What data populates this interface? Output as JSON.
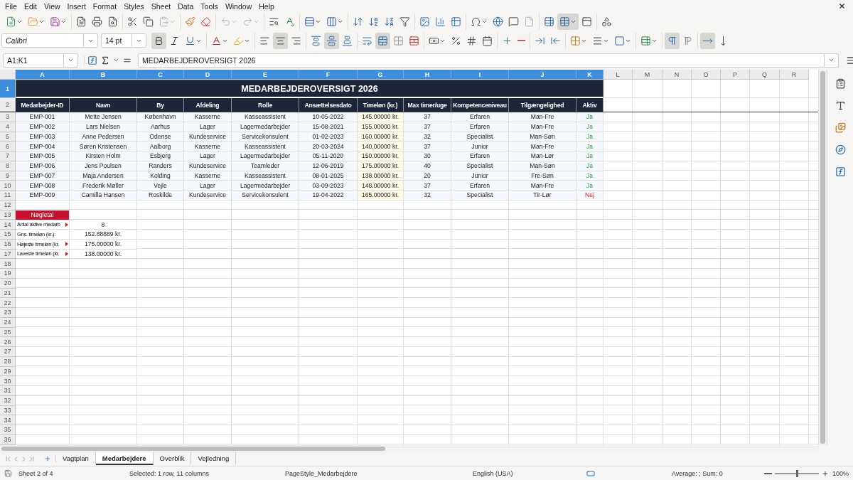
{
  "menu": [
    "File",
    "Edit",
    "View",
    "Insert",
    "Format",
    "Styles",
    "Sheet",
    "Data",
    "Tools",
    "Window",
    "Help"
  ],
  "toolbar": [
    [
      {
        "kind": "new",
        "on": false,
        "disabled": false
      },
      {
        "kind": "open",
        "on": false,
        "disabled": false
      },
      {
        "kind": "save",
        "on": false,
        "disabled": false
      }
    ],
    [
      {
        "kind": "export-pdf",
        "on": false,
        "disabled": false
      },
      {
        "kind": "print",
        "on": false,
        "disabled": false
      },
      {
        "kind": "print-preview",
        "on": false,
        "disabled": false
      }
    ],
    [
      {
        "kind": "cut",
        "on": false,
        "disabled": false
      },
      {
        "kind": "copy",
        "on": false,
        "disabled": false
      },
      {
        "kind": "paste",
        "on": false,
        "disabled": true
      }
    ],
    [
      {
        "kind": "clone",
        "on": false,
        "disabled": false
      },
      {
        "kind": "clear",
        "on": false,
        "disabled": false
      }
    ],
    [
      {
        "kind": "undo",
        "on": false,
        "disabled": true
      },
      {
        "kind": "redo",
        "on": false,
        "disabled": true
      }
    ],
    [
      {
        "kind": "find",
        "on": false,
        "disabled": false
      },
      {
        "kind": "spelling",
        "on": false,
        "disabled": false
      }
    ],
    [
      {
        "kind": "rows",
        "on": false,
        "disabled": false
      },
      {
        "kind": "columns",
        "on": false,
        "disabled": false
      }
    ],
    [
      {
        "kind": "sort",
        "on": false,
        "disabled": false
      },
      {
        "kind": "sort-asc",
        "on": false,
        "disabled": false
      },
      {
        "kind": "sort-desc",
        "on": false,
        "disabled": false
      },
      {
        "kind": "autofilter",
        "on": false,
        "disabled": false
      }
    ],
    [
      {
        "kind": "image",
        "on": false,
        "disabled": false
      },
      {
        "kind": "chart",
        "on": false,
        "disabled": false
      },
      {
        "kind": "pivot",
        "on": false,
        "disabled": false
      }
    ],
    [
      {
        "kind": "special-char",
        "on": false,
        "disabled": false
      },
      {
        "kind": "hyperlink",
        "on": false,
        "disabled": false
      },
      {
        "kind": "comment",
        "on": false,
        "disabled": false
      },
      {
        "kind": "header-footer",
        "on": false,
        "disabled": true
      }
    ],
    [
      {
        "kind": "print-area",
        "on": false,
        "disabled": false
      },
      {
        "kind": "freeze",
        "on": true,
        "disabled": false
      },
      {
        "kind": "split",
        "on": false,
        "disabled": false
      }
    ],
    [
      {
        "kind": "shapes",
        "on": false,
        "disabled": false
      }
    ]
  ],
  "font_name": "Calibri",
  "font_size": "14 pt",
  "format_toolbar": [
    [
      {
        "kind": "bold",
        "on": true
      },
      {
        "kind": "italic",
        "on": false
      },
      {
        "kind": "underline",
        "on": false
      }
    ],
    [
      {
        "kind": "font-color",
        "on": false
      },
      {
        "kind": "highlight",
        "on": false
      }
    ],
    [
      {
        "kind": "align-left",
        "on": false
      },
      {
        "kind": "align-center",
        "on": true
      },
      {
        "kind": "align-right",
        "on": false
      }
    ],
    [
      {
        "kind": "align-top",
        "on": false
      },
      {
        "kind": "align-middle",
        "on": true
      },
      {
        "kind": "align-bottom",
        "on": false
      }
    ],
    [
      {
        "kind": "wrap",
        "on": false
      },
      {
        "kind": "merge-center",
        "on": true
      },
      {
        "kind": "merge",
        "on": false
      },
      {
        "kind": "unmerge",
        "on": false
      }
    ],
    [
      {
        "kind": "currency",
        "on": false
      },
      {
        "kind": "percent",
        "on": false
      },
      {
        "kind": "number",
        "on": false
      },
      {
        "kind": "date",
        "on": false
      }
    ],
    [
      {
        "kind": "add-decimal",
        "on": false
      },
      {
        "kind": "delete-decimal",
        "on": false
      }
    ],
    [
      {
        "kind": "indent-increase",
        "on": false
      },
      {
        "kind": "indent-decrease",
        "on": false
      }
    ],
    [
      {
        "kind": "borders",
        "on": false
      },
      {
        "kind": "border-style",
        "on": false
      },
      {
        "kind": "border-color",
        "on": false
      }
    ],
    [
      {
        "kind": "conditional",
        "on": false
      }
    ],
    [
      {
        "kind": "ltr",
        "on": true
      },
      {
        "kind": "rtl",
        "on": false
      }
    ],
    [
      {
        "kind": "text-lr",
        "on": true
      },
      {
        "kind": "text-tb",
        "on": false
      }
    ]
  ],
  "name_box": "A1:K1",
  "formula": "MEDARBEJDEROVERSIGT 2026",
  "columns": [
    {
      "label": "A",
      "selected": true
    },
    {
      "label": "B",
      "selected": true
    },
    {
      "label": "C",
      "selected": true
    },
    {
      "label": "D",
      "selected": true
    },
    {
      "label": "E",
      "selected": true
    },
    {
      "label": "F",
      "selected": true
    },
    {
      "label": "G",
      "selected": true
    },
    {
      "label": "H",
      "selected": true
    },
    {
      "label": "I",
      "selected": true
    },
    {
      "label": "J",
      "selected": true
    },
    {
      "label": "K",
      "selected": true
    },
    {
      "label": "L",
      "selected": false
    },
    {
      "label": "M",
      "selected": false
    },
    {
      "label": "N",
      "selected": false
    },
    {
      "label": "O",
      "selected": false
    },
    {
      "label": "P",
      "selected": false
    },
    {
      "label": "Q",
      "selected": false
    },
    {
      "label": "R",
      "selected": false
    }
  ],
  "rows": [
    {
      "label": "1",
      "selected": true
    },
    {
      "label": "2",
      "selected": false
    },
    {
      "label": "3",
      "selected": false
    },
    {
      "label": "4",
      "selected": false
    },
    {
      "label": "5",
      "selected": false
    },
    {
      "label": "6",
      "selected": false
    },
    {
      "label": "7",
      "selected": false
    },
    {
      "label": "8",
      "selected": false
    },
    {
      "label": "9",
      "selected": false
    },
    {
      "label": "10",
      "selected": false
    },
    {
      "label": "11",
      "selected": false
    },
    {
      "label": "12",
      "selected": false
    },
    {
      "label": "13",
      "selected": false
    },
    {
      "label": "14",
      "selected": false
    },
    {
      "label": "15",
      "selected": false
    },
    {
      "label": "16",
      "selected": false
    },
    {
      "label": "17",
      "selected": false
    },
    {
      "label": "18",
      "selected": false
    },
    {
      "label": "19",
      "selected": false
    },
    {
      "label": "20",
      "selected": false
    },
    {
      "label": "21",
      "selected": false
    },
    {
      "label": "22",
      "selected": false
    },
    {
      "label": "23",
      "selected": false
    },
    {
      "label": "24",
      "selected": false
    },
    {
      "label": "25",
      "selected": false
    },
    {
      "label": "26",
      "selected": false
    },
    {
      "label": "27",
      "selected": false
    },
    {
      "label": "28",
      "selected": false
    },
    {
      "label": "29",
      "selected": false
    },
    {
      "label": "30",
      "selected": false
    },
    {
      "label": "31",
      "selected": false
    },
    {
      "label": "32",
      "selected": false
    },
    {
      "label": "33",
      "selected": false
    },
    {
      "label": "34",
      "selected": false
    },
    {
      "label": "35",
      "selected": false
    },
    {
      "label": "36",
      "selected": false
    }
  ],
  "title": "MEDARBEJDEROVERSIGT 2026",
  "headers": [
    "Medarbejder-ID",
    "Navn",
    "By",
    "Afdeling",
    "Rolle",
    "Ansættelsesdato",
    "Timeløn (kr.)",
    "Max timer/uge",
    "Kompetenceniveau",
    "Tilgængelighed",
    "Aktiv"
  ],
  "employees": [
    {
      "cells": [
        "EMP-001",
        "Mette Jensen",
        "København",
        "Kasserne",
        "Kasseassistent",
        "10-05-2022",
        "145.00000 kr.",
        "37",
        "Erfaren",
        "Man-Fre"
      ],
      "aktiv": "Ja",
      "active": true
    },
    {
      "cells": [
        "EMP-002",
        "Lars Nielsen",
        "Aarhus",
        "Lager",
        "Lagermedarbejder",
        "15-08-2021",
        "155.00000 kr.",
        "37",
        "Erfaren",
        "Man-Fre"
      ],
      "aktiv": "Ja",
      "active": true
    },
    {
      "cells": [
        "EMP-003",
        "Anne Pedersen",
        "Odense",
        "Kundeservice",
        "Servicekonsulent",
        "01-02-2023",
        "160.00000 kr.",
        "32",
        "Specialist",
        "Man-Søn"
      ],
      "aktiv": "Ja",
      "active": true
    },
    {
      "cells": [
        "EMP-004",
        "Søren Kristensen",
        "Aalborg",
        "Kasserne",
        "Kasseassistent",
        "20-03-2024",
        "140.00000 kr.",
        "37",
        "Junior",
        "Man-Fre"
      ],
      "aktiv": "Ja",
      "active": true
    },
    {
      "cells": [
        "EMP-005",
        "Kirsten Holm",
        "Esbjerg",
        "Lager",
        "Lagermedarbejder",
        "05-11-2020",
        "150.00000 kr.",
        "30",
        "Erfaren",
        "Man-Lør"
      ],
      "aktiv": "Ja",
      "active": true
    },
    {
      "cells": [
        "EMP-006",
        "Jens Poulsen",
        "Randers",
        "Kundeservice",
        "Teamleder",
        "12-06-2019",
        "175.00000 kr.",
        "40",
        "Specialist",
        "Man-Søn"
      ],
      "aktiv": "Ja",
      "active": true
    },
    {
      "cells": [
        "EMP-007",
        "Maja Andersen",
        "Kolding",
        "Kasserne",
        "Kasseassistent",
        "08-01-2025",
        "138.00000 kr.",
        "20",
        "Junior",
        "Fre-Søn"
      ],
      "aktiv": "Ja",
      "active": true
    },
    {
      "cells": [
        "EMP-008",
        "Frederik Møller",
        "Vejle",
        "Lager",
        "Lagermedarbejder",
        "03-09-2023",
        "148.00000 kr.",
        "37",
        "Erfaren",
        "Man-Fre"
      ],
      "aktiv": "Ja",
      "active": true
    },
    {
      "cells": [
        "EMP-009",
        "Camilla Hansen",
        "Roskilde",
        "Kundeservice",
        "Servicekonsulent",
        "19-04-2022",
        "165.00000 kr.",
        "32",
        "Specialist",
        "Tir-Lør"
      ],
      "aktiv": "Nej",
      "active": false
    }
  ],
  "key_figures": {
    "title": "Nøgletal",
    "items": [
      {
        "label": "Antal aktive medarb",
        "value": "8",
        "clipped": true
      },
      {
        "label": "Gns. timeløn (kr.):",
        "value": "152.88889 kr.",
        "clipped": false
      },
      {
        "label": "Højeste timeløn (kr.",
        "value": "175.00000 kr.",
        "clipped": true
      },
      {
        "label": "Laveste timeløn (kr.",
        "value": "138.00000 kr.",
        "clipped": true
      }
    ]
  },
  "sheet_tabs": [
    {
      "label": "Vagtplan",
      "selected": false
    },
    {
      "label": "Medarbejdere",
      "selected": true
    },
    {
      "label": "Overblik",
      "selected": false
    },
    {
      "label": "Vejledning",
      "selected": false
    }
  ],
  "status_bar": {
    "sheet": "Sheet 2 of 4",
    "selection": "Selected: 1 row, 11 columns",
    "page_style": "PageStyle_Medarbejdere",
    "language": "English (USA)",
    "summary": "Average: ; Sum: 0",
    "zoom": {
      "level": 0.5,
      "label": "100%"
    }
  }
}
